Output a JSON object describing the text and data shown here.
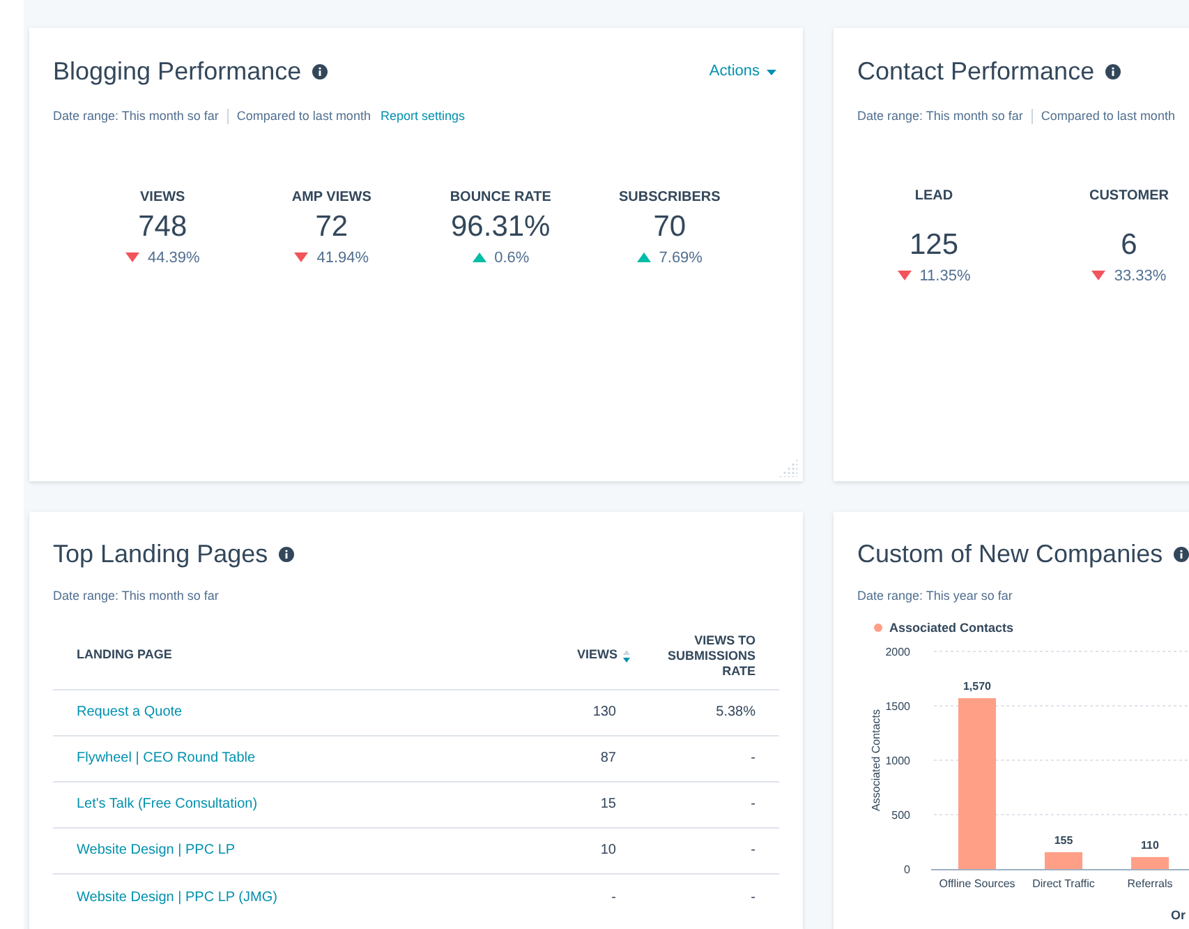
{
  "blogging": {
    "title": "Blogging Performance",
    "actions": "Actions",
    "date_range": "Date range: This month so far",
    "compared": "Compared to last month",
    "settings_link": "Report settings",
    "metrics": [
      {
        "label": "VIEWS",
        "value": "748",
        "change": "44.39%",
        "kind": "down"
      },
      {
        "label": "AMP VIEWS",
        "value": "72",
        "change": "41.94%",
        "kind": "down"
      },
      {
        "label": "BOUNCE RATE",
        "value": "96.31%",
        "change": "0.6%",
        "kind": "up"
      },
      {
        "label": "SUBSCRIBERS",
        "value": "70",
        "change": "7.69%",
        "kind": "up"
      }
    ]
  },
  "contact": {
    "title": "Contact Performance",
    "date_range": "Date range: This month so far",
    "compared": "Compared to last month",
    "metrics": [
      {
        "label": "LEAD",
        "value": "125",
        "change": "11.35%",
        "kind": "down"
      },
      {
        "label": "CUSTOMER",
        "value": "6",
        "change": "33.33%",
        "kind": "down"
      }
    ]
  },
  "landing": {
    "title": "Top Landing Pages",
    "date_range": "Date range: This month so far",
    "columns": [
      "LANDING PAGE",
      "VIEWS",
      "VIEWS TO SUBMISSIONS RATE"
    ],
    "rows": [
      [
        "Request a Quote",
        "130",
        "5.38%"
      ],
      [
        "Flywheel | CEO Round Table",
        "87",
        "-"
      ],
      [
        "Let's Talk (Free Consultation)",
        "15",
        "-"
      ],
      [
        "Website Design | PPC LP",
        "10",
        "-"
      ],
      [
        "Website Design | PPC LP (JMG)",
        "-",
        "-"
      ]
    ]
  },
  "companies": {
    "title": "Custom of New Companies",
    "date_range": "Date range: This year so far",
    "chart_data": {
      "type": "bar",
      "xlabel": "Or",
      "ylabel": "Associated Contacts",
      "categories": [
        "Offline Sources",
        "Direct Traffic",
        "Referrals"
      ],
      "series": [
        {
          "name": "Associated Contacts",
          "color": "#ff9f86",
          "values": [
            1570,
            155,
            110
          ]
        }
      ],
      "grid": true,
      "ylim": [
        0,
        2000
      ],
      "yticks": [
        0,
        500,
        1000,
        1500,
        2000
      ],
      "value_labels": [
        "1,570",
        "155",
        "110"
      ]
    }
  }
}
